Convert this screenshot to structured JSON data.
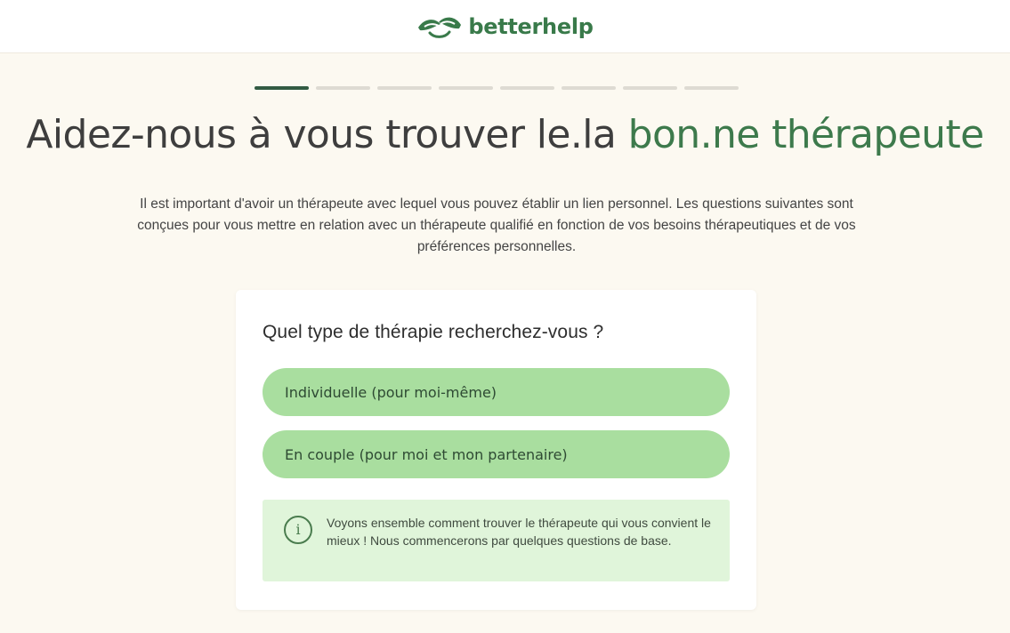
{
  "header": {
    "logo_icon": "leaf-hands-icon",
    "logo_text": "betterhelp"
  },
  "progress": {
    "total_steps": 8,
    "current_step": 1
  },
  "title": {
    "main": "Aidez-nous à vous trouver le.la ",
    "accent": "bon.ne thérapeute"
  },
  "intro": "Il est important d'avoir un thérapeute avec lequel vous pouvez établir un lien personnel. Les questions suivantes sont conçues pour vous mettre en relation avec un thérapeute qualifié en fonction de vos besoins thérapeutiques et de vos préférences personnelles.",
  "card": {
    "question": "Quel type de thérapie recherchez-vous ?",
    "options": [
      {
        "label": "Individuelle (pour moi-même)"
      },
      {
        "label": "En couple (pour moi et mon partenaire)"
      }
    ],
    "info": {
      "icon": "info-icon",
      "icon_glyph": "i",
      "text": "Voyons ensemble comment trouver le thérapeute qui vous convient le mieux ! Nous commencerons par quelques questions de base."
    }
  },
  "colors": {
    "brand": "#397a4a",
    "accent_text": "#3d7a4c",
    "option_bg": "#a9de9f",
    "info_bg": "#e0f5da",
    "page_bg": "#fcf9f1",
    "progress_active": "#325b43",
    "progress_inactive": "#dedbd3"
  }
}
